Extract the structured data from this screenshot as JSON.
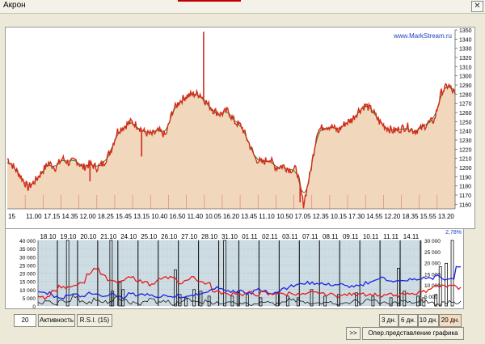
{
  "window": {
    "title": "Акрон",
    "close_glyph": "✕"
  },
  "watermark": "www.MarkStream.ru",
  "chart_data": [
    {
      "type": "line",
      "name": "price",
      "fill": "area",
      "colors": {
        "price": "#d42a1a",
        "ma": "#1c7a1c",
        "area": "#f1d7bc",
        "background": "#ffffff"
      },
      "ylim": [
        1155,
        1350
      ],
      "y_ticks": [
        1350,
        1340,
        1330,
        1320,
        1310,
        1300,
        1290,
        1280,
        1270,
        1260,
        1250,
        1240,
        1230,
        1220,
        1210,
        1200,
        1190,
        1180,
        1170,
        1160
      ],
      "x_tick_labels": [
        "15",
        "11.00",
        "17.15",
        "14.35",
        "12.00",
        "18.25",
        "15.45",
        "13.15",
        "10.40",
        "16.50",
        "11.40",
        "10.05",
        "16.20",
        "13.45",
        "11.10",
        "10.50",
        "17.05",
        "12.35",
        "10.15",
        "17.30",
        "14.55",
        "12.20",
        "18.35",
        "15.55",
        "13.20"
      ],
      "key_points": [
        [
          0,
          1210
        ],
        [
          2,
          1200
        ],
        [
          4,
          1190
        ],
        [
          6,
          1178
        ],
        [
          8,
          1185
        ],
        [
          10,
          1195
        ],
        [
          12,
          1205
        ],
        [
          14,
          1200
        ],
        [
          16,
          1210
        ],
        [
          18,
          1205
        ],
        [
          20,
          1208
        ],
        [
          22,
          1200
        ],
        [
          24,
          1204
        ],
        [
          26,
          1200
        ],
        [
          28,
          1205
        ],
        [
          30,
          1218
        ],
        [
          32,
          1240
        ],
        [
          34,
          1245
        ],
        [
          36,
          1250
        ],
        [
          38,
          1245
        ],
        [
          40,
          1238
        ],
        [
          42,
          1236
        ],
        [
          44,
          1240
        ],
        [
          46,
          1235
        ],
        [
          48,
          1262
        ],
        [
          50,
          1272
        ],
        [
          52,
          1278
        ],
        [
          54,
          1280
        ],
        [
          56,
          1280
        ],
        [
          58,
          1270
        ],
        [
          60,
          1262
        ],
        [
          62,
          1258
        ],
        [
          64,
          1262
        ],
        [
          66,
          1250
        ],
        [
          68,
          1245
        ],
        [
          70,
          1228
        ],
        [
          72,
          1210
        ],
        [
          74,
          1205
        ],
        [
          76,
          1210
        ],
        [
          78,
          1200
        ],
        [
          80,
          1202
        ],
        [
          82,
          1198
        ],
        [
          84,
          1198
        ],
        [
          86,
          1160
        ],
        [
          88,
          1195
        ],
        [
          90,
          1240
        ],
        [
          92,
          1245
        ],
        [
          94,
          1245
        ],
        [
          96,
          1240
        ],
        [
          98,
          1248
        ],
        [
          100,
          1252
        ],
        [
          102,
          1262
        ],
        [
          104,
          1268
        ],
        [
          106,
          1262
        ],
        [
          108,
          1250
        ],
        [
          110,
          1244
        ],
        [
          112,
          1240
        ],
        [
          114,
          1242
        ],
        [
          116,
          1245
        ],
        [
          118,
          1240
        ],
        [
          120,
          1242
        ],
        [
          122,
          1248
        ],
        [
          124,
          1252
        ],
        [
          126,
          1282
        ],
        [
          128,
          1290
        ],
        [
          130,
          1280
        ]
      ],
      "spikes": [
        [
          57,
          1348,
          "up"
        ],
        [
          24,
          1185,
          "down"
        ],
        [
          39,
          1212,
          "down"
        ],
        [
          85,
          1162,
          "down"
        ],
        [
          96,
          1238,
          "down"
        ]
      ]
    },
    {
      "type": "line",
      "name": "activity",
      "percent_label": "2,78%",
      "date_labels": [
        "18.10",
        "19.10",
        "20.10",
        "21.10",
        "24.10",
        "25.10",
        "26.10",
        "27.10",
        "28.10",
        "31.10",
        "01.11",
        "02.11",
        "03.11",
        "07.11",
        "08.11",
        "09.11",
        "10.11",
        "11.11",
        "14.11"
      ],
      "left_axis": [
        "40 000",
        "35 000",
        "30 000",
        "25 000",
        "20 000",
        "15 000",
        "10 000",
        "5 000",
        "0"
      ],
      "right_axis": [
        "30 000",
        "25 000",
        "20 000",
        "15 000",
        "10 000",
        "5 000"
      ],
      "ylim": [
        0,
        40000
      ],
      "series": [
        {
          "color": "#1b23e6",
          "values": [
            8000,
            8000,
            6000,
            5000,
            7000,
            8000,
            6000,
            8000,
            8000,
            6000,
            7000,
            6000,
            5000,
            8000,
            7000,
            7000,
            6000,
            5000,
            6000,
            5000,
            6000,
            5000,
            7000,
            7000,
            9000,
            11000,
            10000,
            9000,
            9000,
            9000,
            8000,
            10000,
            9000,
            8000,
            9000,
            11000,
            12000,
            13000,
            14000,
            14000,
            14000,
            13000,
            13000,
            13000,
            12000,
            12000,
            12000,
            14000,
            16000,
            17000,
            16000,
            15000,
            15000,
            16000,
            16000,
            17000,
            17000,
            18000,
            16000,
            17000,
            24000
          ]
        },
        {
          "color": "#e51c1c",
          "values": [
            5000,
            5000,
            10000,
            12000,
            11000,
            13000,
            14000,
            20000,
            23000,
            19000,
            16000,
            15000,
            16000,
            18000,
            15000,
            14000,
            13000,
            16000,
            17000,
            18000,
            14000,
            16000,
            17000,
            15000,
            14000,
            9000,
            8000,
            7000,
            8000,
            7000,
            8000,
            7000,
            8000,
            7000,
            8000,
            7000,
            8000,
            7000,
            7000,
            8000,
            8000,
            7000,
            7000,
            6000,
            7000,
            7000,
            8000,
            7000,
            7000,
            6000,
            7000,
            6000,
            7000,
            7000,
            8000,
            9000,
            11000,
            12000,
            12000,
            12000,
            11000
          ]
        },
        {
          "color": "#1a1a1a",
          "values": [
            2000,
            3000,
            1000,
            4000,
            2000,
            6000,
            3000,
            2000,
            4000,
            3000,
            2000,
            5000,
            3000,
            2000,
            1000,
            3000,
            4000,
            2000,
            3000,
            1000,
            2000,
            4000,
            3000,
            2000,
            3000,
            2000,
            1000,
            3000,
            2000,
            2000,
            1000,
            2000,
            3000,
            2000,
            1000,
            2000,
            4000,
            3000,
            2000,
            1000,
            2000,
            3000,
            2000,
            1000,
            2000,
            3000,
            2000,
            4000,
            3000,
            2000,
            1000,
            2000,
            3000,
            2000,
            2000,
            3000,
            2000,
            1000,
            2000,
            3000,
            2000
          ]
        }
      ],
      "bars": [
        [
          38,
          40000
        ],
        [
          96,
          40000
        ],
        [
          98,
          9000
        ],
        [
          108,
          15000
        ],
        [
          112,
          10000
        ],
        [
          182,
          22000
        ],
        [
          188,
          7000
        ],
        [
          196,
          5000
        ],
        [
          207,
          10000
        ],
        [
          216,
          9000
        ],
        [
          227,
          6000
        ],
        [
          248,
          40000
        ],
        [
          258,
          6000
        ],
        [
          266,
          9000
        ],
        [
          278,
          7000
        ],
        [
          296,
          5000
        ],
        [
          318,
          8000
        ],
        [
          332,
          6000
        ],
        [
          346,
          5000
        ],
        [
          364,
          10000
        ],
        [
          382,
          6000
        ],
        [
          400,
          7000
        ],
        [
          424,
          8000
        ],
        [
          446,
          6000
        ],
        [
          470,
          5000
        ],
        [
          480,
          23000
        ],
        [
          488,
          9000
        ],
        [
          506,
          6000
        ],
        [
          514,
          5000
        ],
        [
          530,
          7000
        ],
        [
          536,
          24000
        ],
        [
          544,
          26000
        ],
        [
          552,
          40000
        ]
      ]
    }
  ],
  "controls": {
    "period_value": "20",
    "activity_label": "Активность",
    "rsi_label": "R.S.I. (15)",
    "nav_label": ">>",
    "range_buttons": [
      "3 дн.",
      "6 дн.",
      "10 дн.",
      "20 дн."
    ],
    "selected_range": "20 дн.",
    "oper_label": "Опер.представление графика"
  }
}
